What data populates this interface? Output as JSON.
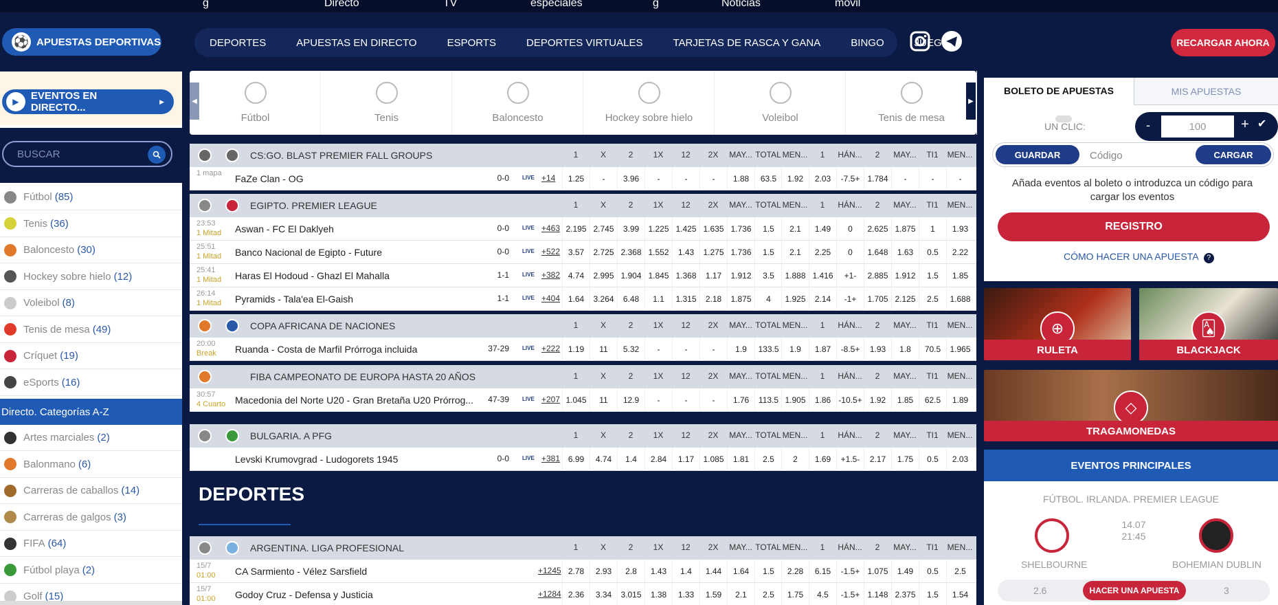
{
  "topstrip": [
    "g",
    "Directo",
    "TV",
    "especiales",
    "g",
    "Noticias",
    "móvil"
  ],
  "header": {
    "sports_btn": "APUESTAS DEPORTIVAS",
    "nav": [
      "DEPORTES",
      "APUESTAS EN DIRECTO",
      "ESPORTS",
      "DEPORTES VIRTUALES",
      "TARJETAS DE RASCA Y GANA",
      "BINGO",
      "JUEGOS"
    ],
    "recargar": "RECARGAR AHORA"
  },
  "sidebar": {
    "live_btn": "EVENTOS EN DIRECTO...",
    "search_placeholder": "BUSCAR",
    "sports": [
      {
        "label": "Fútbol",
        "count": "(85)",
        "color": "#888"
      },
      {
        "label": "Tenis",
        "count": "(36)",
        "color": "#d6d23a"
      },
      {
        "label": "Baloncesto",
        "count": "(30)",
        "color": "#e07a2a"
      },
      {
        "label": "Hockey sobre hielo",
        "count": "(12)",
        "color": "#555"
      },
      {
        "label": "Voleibol",
        "count": "(8)",
        "color": "#ccc"
      },
      {
        "label": "Tenis de mesa",
        "count": "(49)",
        "color": "#e03a2a"
      },
      {
        "label": "Críquet",
        "count": "(19)",
        "color": "#c8243a"
      },
      {
        "label": "eSports",
        "count": "(16)",
        "color": "#444"
      }
    ],
    "categories_title": "Directo. Categorías A-Z",
    "categories": [
      {
        "label": "Artes marciales",
        "count": "(2)",
        "color": "#333"
      },
      {
        "label": "Balonmano",
        "count": "(6)",
        "color": "#e07a2a"
      },
      {
        "label": "Carreras de caballos",
        "count": "(14)",
        "color": "#a06a2a"
      },
      {
        "label": "Carreras de galgos",
        "count": "(3)",
        "color": "#b08a4a"
      },
      {
        "label": "FIFA",
        "count": "(64)",
        "color": "#333"
      },
      {
        "label": "Fútbol playa",
        "count": "(2)",
        "color": "#3a9a3a"
      },
      {
        "label": "Golf",
        "count": "(15)",
        "color": "#ccc"
      }
    ]
  },
  "sport_tabs": [
    "Fútbol",
    "Tenis",
    "Baloncesto",
    "Hockey sobre hielo",
    "Voleibol",
    "Tenis de mesa"
  ],
  "odds_headers": [
    "1",
    "X",
    "2",
    "1X",
    "12",
    "2X",
    "MAY...",
    "TOTAL",
    "MEN...",
    "1",
    "HÁN...",
    "2",
    "MAY...",
    "TI1",
    "MEN..."
  ],
  "leagues": [
    {
      "name": "CS:GO. BLAST PREMIER FALL GROUPS",
      "c1": "#666",
      "c2": "#666",
      "rows": [
        {
          "t1": "1 mapa",
          "t2": "",
          "teams": "FaZe Clan - OG",
          "score": "0-0",
          "more": "+14",
          "odds": [
            "1.25",
            "-",
            "3.96",
            "-",
            "-",
            "-",
            "1.88",
            "63.5",
            "1.92",
            "2.03",
            "-7.5+",
            "1.784",
            "-",
            "-",
            "-"
          ]
        }
      ]
    },
    {
      "name": "EGIPTO. PREMIER LEAGUE",
      "c1": "#888",
      "c2": "#c8243a",
      "rows": [
        {
          "t1": "23:53",
          "t2": "1 Mitad",
          "teams": "Aswan - FC El Daklyeh",
          "score": "0-0",
          "more": "+463",
          "odds": [
            "2.195",
            "2.745",
            "3.99",
            "1.225",
            "1.425",
            "1.635",
            "1.736",
            "1.5",
            "2.1",
            "1.49",
            "0",
            "2.625",
            "1.875",
            "1",
            "1.93"
          ]
        },
        {
          "t1": "25:51",
          "t2": "1 Mitad",
          "teams": "Banco Nacional de Egipto - Future",
          "score": "0-0",
          "more": "+522",
          "odds": [
            "3.57",
            "2.725",
            "2.368",
            "1.552",
            "1.43",
            "1.275",
            "1.736",
            "1.5",
            "2.1",
            "2.25",
            "0",
            "1.648",
            "1.63",
            "0.5",
            "2.22"
          ]
        },
        {
          "t1": "25:41",
          "t2": "1 Mitad",
          "teams": "Haras El Hodoud - Ghazl El Mahalla",
          "score": "1-1",
          "more": "+382",
          "odds": [
            "4.74",
            "2.995",
            "1.904",
            "1.845",
            "1.368",
            "1.17",
            "1.912",
            "3.5",
            "1.888",
            "1.416",
            "+1-",
            "2.885",
            "1.912",
            "1.5",
            "1.85"
          ]
        },
        {
          "t1": "26:14",
          "t2": "1 Mitad",
          "teams": "Pyramids - Tala'ea El-Gaish",
          "score": "1-1",
          "more": "+404",
          "odds": [
            "1.64",
            "3.264",
            "6.48",
            "1.1",
            "1.315",
            "2.18",
            "1.875",
            "4",
            "1.925",
            "2.14",
            "-1+",
            "1.705",
            "2.125",
            "2.5",
            "1.688"
          ]
        }
      ]
    },
    {
      "name": "COPA AFRICANA DE NACIONES",
      "c1": "#e07a2a",
      "c2": "#2a58a8",
      "rows": [
        {
          "t1": "20:00",
          "t2": "Break",
          "teams": "Ruanda - Costa de Marfil Prórroga incluida",
          "score": "37-29",
          "more": "+222",
          "odds": [
            "1.19",
            "11",
            "5.32",
            "-",
            "-",
            "-",
            "1.9",
            "133.5",
            "1.9",
            "1.87",
            "-8.5+",
            "1.93",
            "1.8",
            "70.5",
            "1.965"
          ]
        }
      ]
    },
    {
      "name": "FIBA CAMPEONATO DE EUROPA HASTA 20 AÑOS",
      "c1": "#e07a2a",
      "c2": "",
      "rows": [
        {
          "t1": "30:57",
          "t2": "4 Cuarto",
          "teams": "Macedonia del Norte U20 - Gran Bretaña U20 Prórrog...",
          "score": "47-39",
          "more": "+207",
          "odds": [
            "1.045",
            "11",
            "12.9",
            "-",
            "-",
            "-",
            "1.76",
            "113.5",
            "1.905",
            "1.86",
            "-10.5+",
            "1.92",
            "1.85",
            "62.5",
            "1.89"
          ]
        }
      ]
    },
    {
      "name": "BULGARIA. A PFG",
      "c1": "#888",
      "c2": "#3a9a3a",
      "rows": [
        {
          "t1": "",
          "t2": "",
          "teams": "Levski Krumovgrad - Ludogorets 1945",
          "score": "0-0",
          "more": "+381",
          "odds": [
            "6.99",
            "4.74",
            "1.4",
            "2.84",
            "1.17",
            "1.085",
            "1.81",
            "2.5",
            "2",
            "1.69",
            "+1.5-",
            "2.17",
            "1.75",
            "0.5",
            "2.03"
          ]
        }
      ]
    }
  ],
  "deportes_title": "DEPORTES",
  "deportes_league": {
    "name": "ARGENTINA. LIGA PROFESIONAL",
    "c1": "#888",
    "c2": "#7ab0e0",
    "rows": [
      {
        "t1": "15/7",
        "t2": "01:00",
        "teams": "CA Sarmiento - Vélez Sarsfield",
        "score": "",
        "more": "+1245",
        "odds": [
          "2.78",
          "2.93",
          "2.8",
          "1.43",
          "1.4",
          "1.44",
          "1.64",
          "1.5",
          "2.28",
          "6.15",
          "-1.5+",
          "1.075",
          "1.49",
          "0.5",
          "2.5"
        ]
      },
      {
        "t1": "15/7",
        "t2": "01:00",
        "teams": "Godoy Cruz - Defensa y Justicia",
        "score": "",
        "more": "+1284",
        "odds": [
          "2.36",
          "3.34",
          "3.015",
          "1.38",
          "1.33",
          "1.59",
          "2.1",
          "2.5",
          "1.75",
          "4.5",
          "-1.5+",
          "1.148",
          "2.375",
          "1.5",
          "1.54"
        ]
      }
    ]
  },
  "live_label": "LIVE",
  "betslip": {
    "tab1": "BOLETO DE APUESTAS",
    "tab2": "MIS APUESTAS",
    "one_click": "UN CLIC:",
    "minus": "-",
    "stake": "100",
    "plus": "+",
    "guardar": "GUARDAR",
    "code_placeholder": "Código",
    "cargar": "CARGAR",
    "info": "Añada eventos al boleto o introduzca un código para cargar los eventos",
    "registro": "REGISTRO",
    "howto": "CÓMO HACER UNA APUESTA"
  },
  "promos": [
    "RULETA",
    "BLACKJACK",
    "TRAGAMONEDAS"
  ],
  "top_events": {
    "title": "EVENTOS PRINCIPALES",
    "league": "FÚTBOL. IRLANDA. PREMIER LEAGUE",
    "date": "14.07",
    "time": "21:45",
    "home": "SHELBOURNE",
    "away": "BOHEMIAN DUBLIN",
    "odd_home": "2.6",
    "button": "HACER UNA APUESTA",
    "odd_away": "3"
  }
}
